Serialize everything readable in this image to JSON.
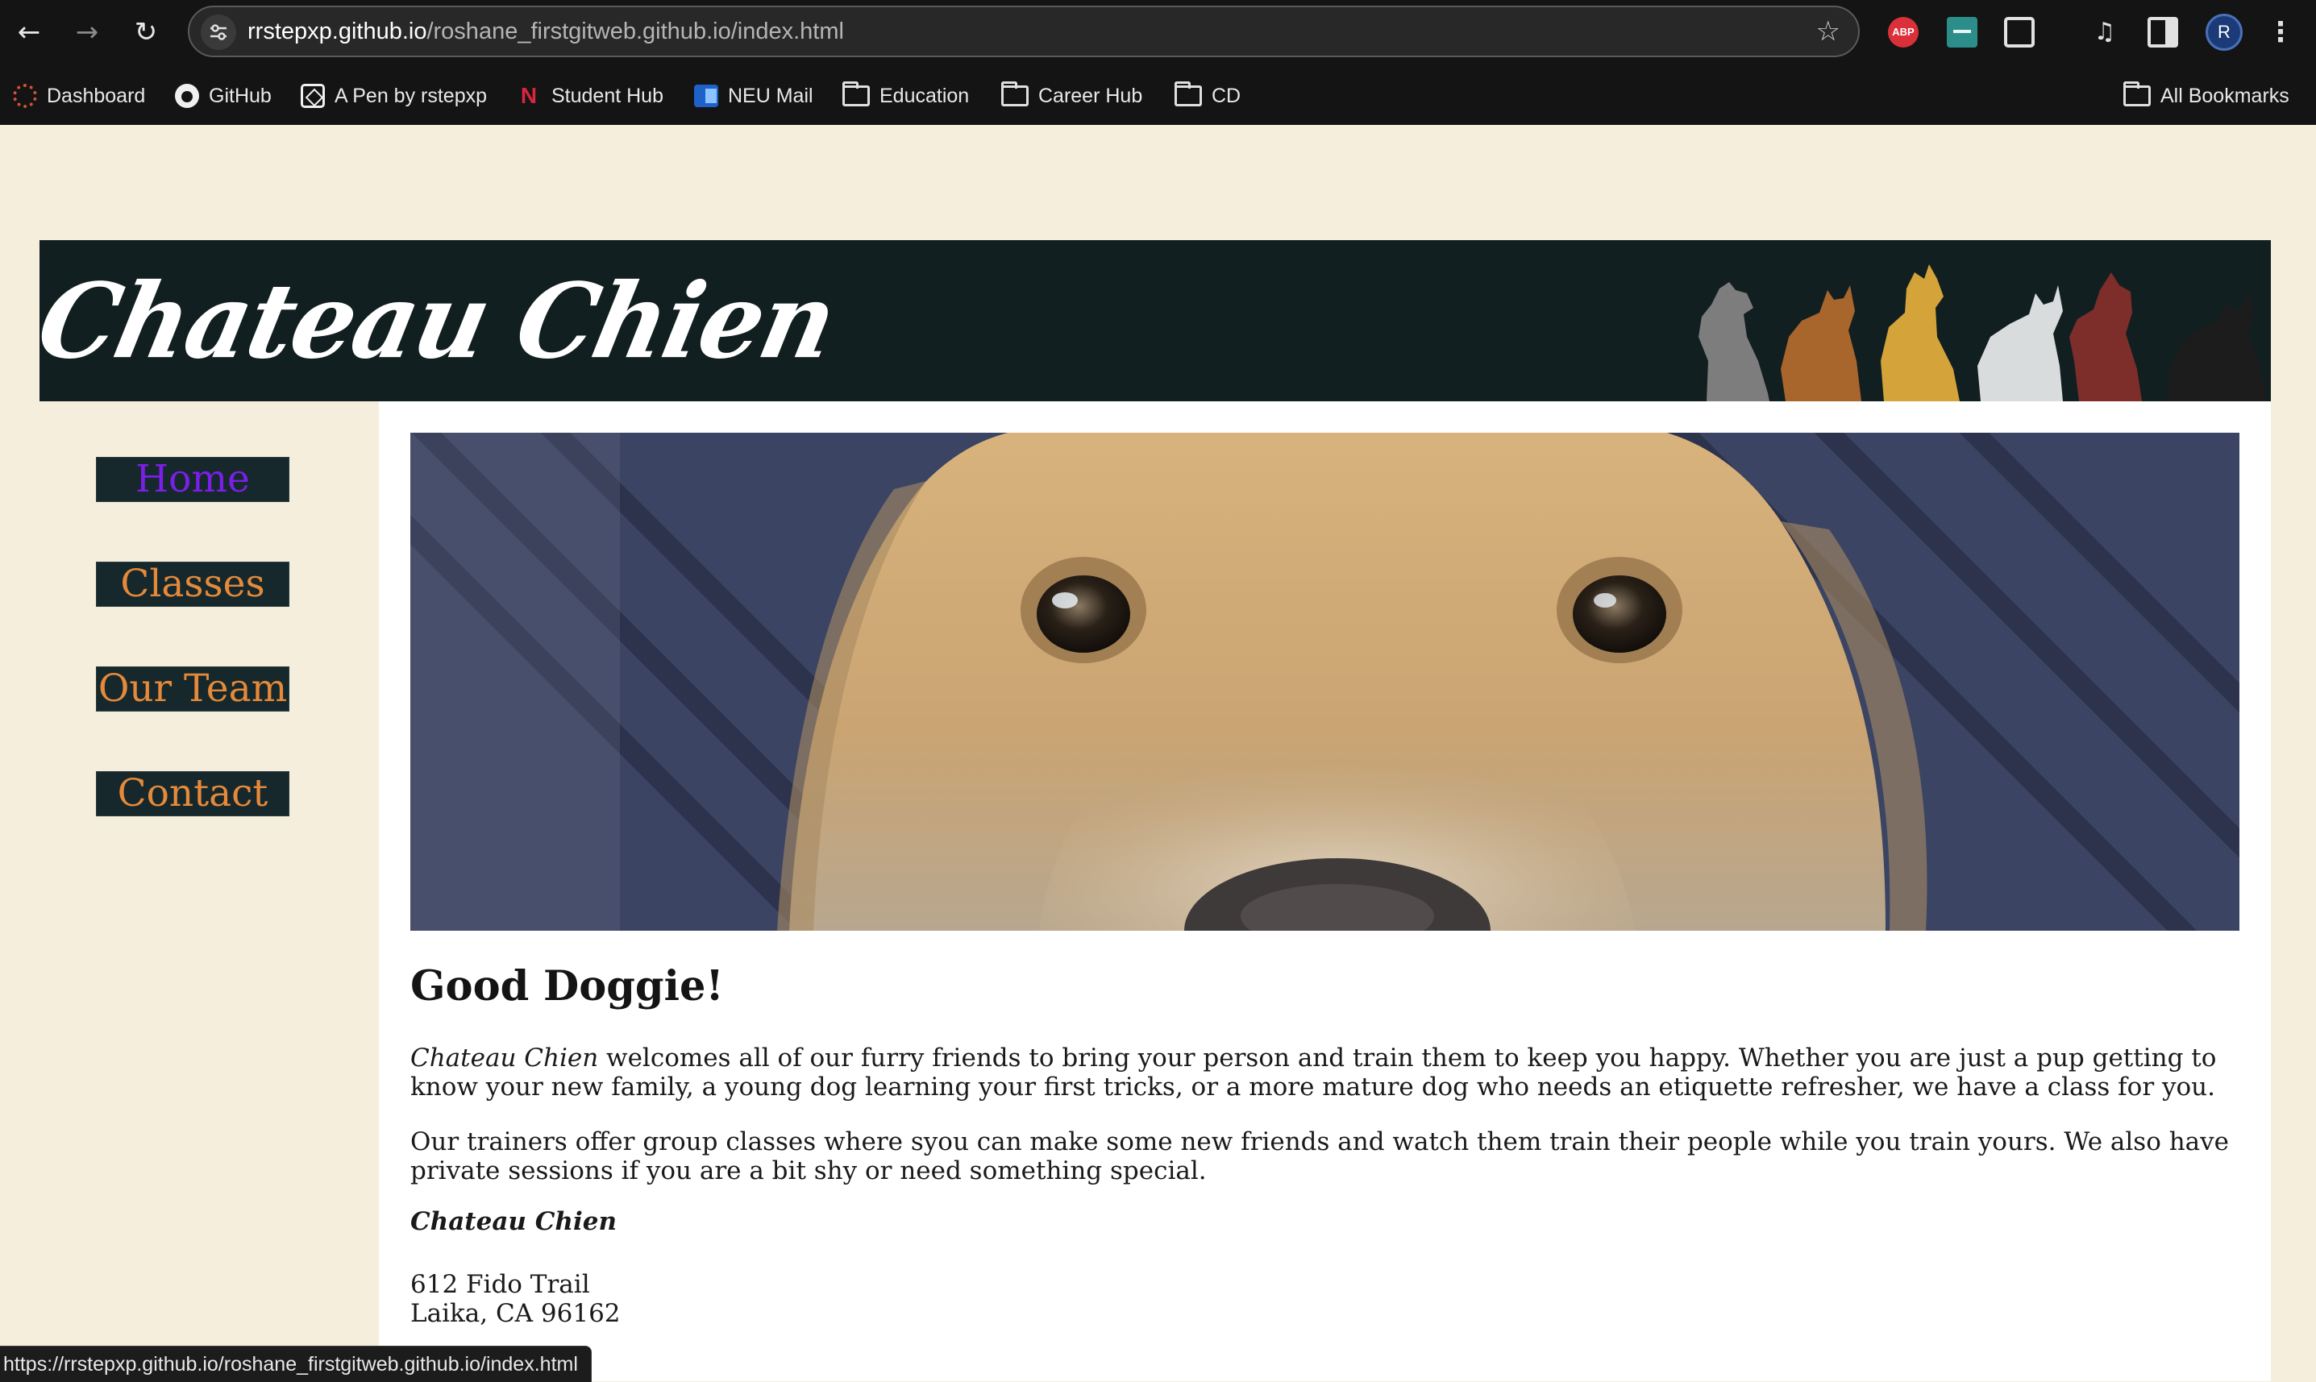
{
  "browser": {
    "url_host": "rrstepxp.github.io",
    "url_path": "/roshane_firstgitweb.github.io/index.html",
    "avatar_letter": "R",
    "abp_label": "ABP",
    "status_url": "https://rrstepxp.github.io/roshane_firstgitweb.github.io/index.html",
    "bookmarks": [
      {
        "label": "Dashboard",
        "icon": "canvas-dashboard-icon"
      },
      {
        "label": "GitHub",
        "icon": "github-icon"
      },
      {
        "label": "A Pen by rstepxp",
        "icon": "codepen-icon"
      },
      {
        "label": "Student Hub",
        "icon": "northeastern-icon"
      },
      {
        "label": "NEU Mail",
        "icon": "outlook-icon"
      },
      {
        "label": "Education",
        "icon": "folder-icon"
      },
      {
        "label": "Career Hub",
        "icon": "folder-icon"
      },
      {
        "label": "CD",
        "icon": "folder-icon"
      }
    ],
    "all_bookmarks": "All Bookmarks"
  },
  "site": {
    "logo": "Chateau Chien",
    "nav": [
      {
        "label": "Home",
        "active": true
      },
      {
        "label": "Classes"
      },
      {
        "label": "Our Team"
      },
      {
        "label": "Contact"
      }
    ],
    "heading": "Good Doggie!",
    "para1_em": "Chateau Chien",
    "para1_rest": " welcomes all of our furry friends to bring your person and train them to keep you happy. Whether you are just a pup getting to know your new family, a young dog learning your first tricks, or a more mature dog who needs an etiquette refresher, we have a class for you.",
    "para2": "Our trainers offer group classes where syou can make some new friends and watch them train their people while you train yours. We also have private sessions if you are a bit shy or need something special.",
    "business_name": "Chateau Chien",
    "address_line1": "612 Fido Trail",
    "address_line2": "Laika, CA 96162"
  },
  "colors": {
    "page_bg": "#f6eedc",
    "header_bg": "#121f21",
    "nav_text": "#e5893a",
    "nav_active": "#7b1fe8"
  }
}
